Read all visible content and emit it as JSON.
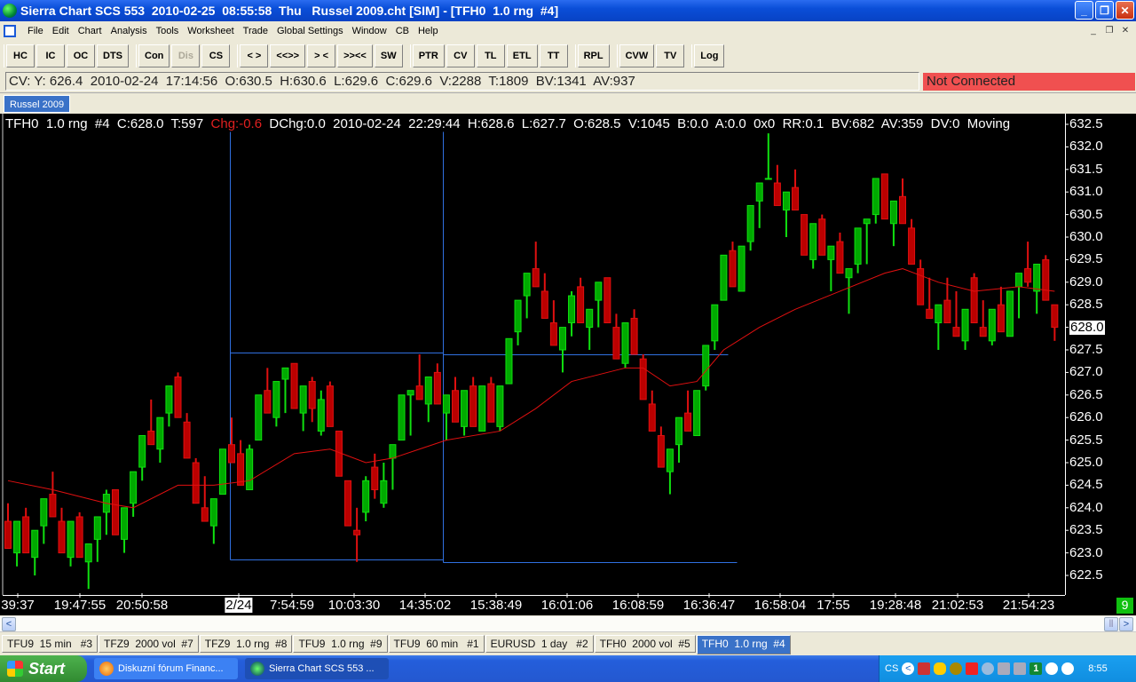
{
  "window": {
    "title": "Sierra Chart SCS 553  2010-02-25  08:55:58  Thu   Russel 2009.cht [SIM] - [TFH0  1.0 rng  #4]",
    "minimize": "_",
    "restore": "❐",
    "close": "✕"
  },
  "menu": [
    "File",
    "Edit",
    "Chart",
    "Analysis",
    "Tools",
    "Worksheet",
    "Trade",
    "Global Settings",
    "Window",
    "CB",
    "Help"
  ],
  "mdi": {
    "minimize": "_",
    "restore": "❐",
    "close": "✕"
  },
  "toolbar": [
    [
      "HC",
      "IC",
      "OC",
      "DTS"
    ],
    [
      "Con",
      "Dis",
      "CS"
    ],
    [
      "< >",
      "<<>>",
      "> <",
      ">><<",
      "SW"
    ],
    [
      "PTR",
      "CV",
      "TL",
      "ETL",
      "TT"
    ],
    [
      "RPL"
    ],
    [
      "CVW",
      "TV"
    ],
    [
      "Log"
    ]
  ],
  "toolbar_disabled": [
    "Dis"
  ],
  "infobar": {
    "text": "CV: Y: 626.4  2010-02-24  17:14:56  O:630.5  H:630.6  L:629.6  C:629.6  V:2288  T:1809  BV:1341  AV:937",
    "status": "Not Connected",
    "status_color": "#f05050"
  },
  "chartbook_tab": "Russel 2009",
  "chart": {
    "header_a": "TFH0  1.0 rng  #4  C:628.0  T:597  ",
    "header_chg": "Chg:-0.6",
    "header_b": "  DChg:0.0  2010-02-24  22:29:44  H:628.6  L:627.7  O:628.5  V:1045  B:0.0  A:0.0  0x0  RR:0.1  BV:682  AV:359  DV:0  Moving",
    "current_price": "628.0",
    "bar_count": "9",
    "up_color": "#10e010",
    "down_color": "#e01010",
    "ma_color": "#e01010",
    "drawing_color": "#3070e0"
  },
  "chart_data": {
    "type": "candlestick",
    "ylim": [
      622.5,
      632.5
    ],
    "yticks": [
      "632.5",
      "632.0",
      "631.5",
      "631.0",
      "630.5",
      "630.0",
      "629.5",
      "629.0",
      "628.5",
      "628.0",
      "627.5",
      "627.0",
      "626.5",
      "626.0",
      "625.5",
      "625.0",
      "624.5",
      "624.0",
      "623.5",
      "623.0",
      "622.5"
    ],
    "xticks": [
      "39:37",
      "19:47:55",
      "20:50:58",
      "2/24",
      "7:54:59",
      "10:03:30",
      "14:35:02",
      "15:38:49",
      "16:01:06",
      "16:08:59",
      "16:36:47",
      "16:58:04",
      "17:55",
      "19:28:48",
      "21:02:53",
      "21:54:23"
    ],
    "ohlc": [
      [
        623.7,
        624.1,
        623.1,
        623.1
      ],
      [
        623.0,
        623.7,
        622.7,
        623.7
      ],
      [
        623.8,
        624.0,
        623.0,
        623.0
      ],
      [
        622.9,
        623.5,
        622.5,
        623.5
      ],
      [
        623.6,
        624.2,
        623.2,
        624.2
      ],
      [
        624.3,
        624.8,
        623.8,
        623.8
      ],
      [
        623.7,
        624.0,
        623.0,
        623.0
      ],
      [
        622.9,
        623.7,
        622.7,
        623.7
      ],
      [
        623.8,
        623.9,
        622.9,
        622.9
      ],
      [
        622.8,
        623.2,
        622.2,
        623.2
      ],
      [
        623.3,
        623.8,
        622.8,
        623.8
      ],
      [
        623.9,
        624.4,
        623.4,
        624.3
      ],
      [
        624.4,
        624.4,
        623.4,
        623.4
      ],
      [
        623.3,
        624.0,
        623.0,
        624.0
      ],
      [
        624.1,
        624.8,
        623.8,
        624.8
      ],
      [
        624.9,
        625.6,
        624.6,
        625.6
      ],
      [
        625.7,
        626.4,
        625.4,
        625.4
      ],
      [
        625.3,
        626.0,
        625.0,
        626.0
      ],
      [
        626.1,
        626.7,
        625.8,
        626.7
      ],
      [
        626.9,
        627.0,
        626.0,
        626.0
      ],
      [
        625.9,
        626.1,
        625.1,
        625.1
      ],
      [
        625.0,
        625.1,
        624.1,
        624.1
      ],
      [
        624.0,
        624.7,
        623.7,
        623.7
      ],
      [
        623.6,
        624.2,
        623.2,
        624.2
      ],
      [
        624.3,
        625.3,
        624.3,
        625.3
      ],
      [
        625.4,
        626.0,
        625.0,
        625.0
      ],
      [
        625.2,
        625.5,
        624.5,
        624.5
      ],
      [
        624.4,
        625.4,
        624.4,
        625.3
      ],
      [
        625.5,
        626.5,
        625.5,
        626.5
      ],
      [
        626.6,
        627.1,
        626.1,
        626.1
      ],
      [
        626.0,
        626.8,
        625.8,
        626.8
      ],
      [
        626.85,
        627.1,
        626.1,
        627.1
      ],
      [
        627.2,
        627.2,
        626.2,
        626.2
      ],
      [
        626.1,
        626.7,
        625.7,
        626.7
      ],
      [
        626.8,
        626.9,
        625.9,
        626.2
      ],
      [
        625.7,
        626.6,
        625.6,
        626.4
      ],
      [
        626.7,
        626.8,
        625.8,
        625.8
      ],
      [
        625.7,
        625.7,
        624.7,
        624.7
      ],
      [
        624.6,
        624.6,
        623.6,
        623.6
      ],
      [
        623.5,
        624.0,
        622.8,
        623.4
      ],
      [
        623.9,
        624.7,
        623.7,
        624.6
      ],
      [
        624.9,
        625.2,
        624.2,
        624.4
      ],
      [
        624.1,
        625.0,
        624.0,
        624.6
      ],
      [
        625.1,
        625.4,
        624.4,
        625.4
      ],
      [
        625.5,
        626.5,
        625.5,
        626.5
      ],
      [
        626.5,
        626.6,
        625.6,
        626.6
      ],
      [
        626.7,
        627.4,
        626.4,
        626.4
      ],
      [
        626.3,
        626.9,
        625.9,
        626.9
      ],
      [
        627.0,
        627.2,
        626.3,
        626.3
      ],
      [
        626.1,
        626.5,
        625.5,
        626.5
      ],
      [
        626.6,
        626.9,
        625.9,
        625.9
      ],
      [
        625.8,
        626.6,
        625.6,
        626.6
      ],
      [
        626.7,
        626.9,
        625.8,
        625.8
      ],
      [
        625.7,
        626.7,
        625.7,
        626.7
      ],
      [
        626.75,
        626.9,
        625.9,
        625.9
      ],
      [
        625.8,
        626.7,
        625.7,
        626.7
      ],
      [
        626.75,
        627.75,
        626.75,
        627.75
      ],
      [
        627.9,
        628.6,
        627.6,
        628.6
      ],
      [
        628.7,
        629.2,
        628.2,
        629.2
      ],
      [
        629.3,
        629.9,
        628.9,
        628.9
      ],
      [
        628.8,
        629.2,
        628.2,
        628.2
      ],
      [
        628.1,
        628.6,
        627.6,
        627.6
      ],
      [
        627.5,
        628.0,
        627.0,
        628.0
      ],
      [
        628.1,
        628.8,
        627.8,
        628.7
      ],
      [
        628.9,
        629.1,
        628.1,
        628.1
      ],
      [
        628.0,
        628.4,
        627.5,
        628.4
      ],
      [
        628.6,
        629.0,
        628.0,
        629.0
      ],
      [
        629.1,
        629.1,
        628.1,
        628.1
      ],
      [
        628.0,
        628.3,
        627.3,
        627.3
      ],
      [
        627.2,
        628.1,
        627.1,
        628.1
      ],
      [
        628.2,
        628.4,
        627.4,
        627.4
      ],
      [
        627.3,
        627.4,
        626.4,
        626.4
      ],
      [
        626.3,
        626.6,
        625.7,
        625.7
      ],
      [
        625.6,
        625.8,
        624.9,
        624.9
      ],
      [
        624.8,
        625.3,
        624.3,
        625.3
      ],
      [
        625.4,
        626.0,
        625.0,
        626.0
      ],
      [
        626.1,
        626.6,
        625.7,
        625.7
      ],
      [
        625.6,
        626.6,
        625.6,
        626.6
      ],
      [
        626.7,
        627.6,
        626.6,
        627.6
      ],
      [
        627.7,
        628.5,
        627.5,
        628.5
      ],
      [
        628.6,
        629.6,
        628.6,
        629.6
      ],
      [
        629.7,
        629.9,
        628.9,
        628.9
      ],
      [
        628.8,
        629.8,
        628.8,
        629.8
      ],
      [
        629.9,
        630.7,
        629.7,
        630.7
      ],
      [
        630.8,
        631.2,
        630.2,
        631.2
      ],
      [
        631.3,
        632.3,
        631.3,
        631.3
      ],
      [
        631.2,
        631.6,
        630.7,
        630.7
      ],
      [
        630.6,
        631.0,
        630.0,
        631.0
      ],
      [
        631.1,
        631.5,
        630.6,
        630.6
      ],
      [
        630.5,
        630.5,
        629.6,
        629.6
      ],
      [
        629.5,
        630.3,
        629.3,
        630.3
      ],
      [
        630.4,
        630.5,
        629.6,
        629.6
      ],
      [
        629.5,
        629.8,
        628.8,
        629.8
      ],
      [
        629.9,
        630.1,
        629.2,
        629.2
      ],
      [
        629.1,
        629.3,
        628.3,
        629.3
      ],
      [
        629.4,
        630.2,
        629.2,
        630.2
      ],
      [
        630.3,
        630.4,
        629.4,
        630.4
      ],
      [
        630.5,
        631.3,
        630.3,
        631.3
      ],
      [
        631.4,
        631.4,
        630.4,
        630.4
      ],
      [
        630.3,
        630.8,
        629.8,
        630.8
      ],
      [
        630.9,
        631.3,
        630.3,
        630.3
      ],
      [
        630.2,
        630.4,
        629.4,
        629.4
      ],
      [
        629.3,
        629.5,
        628.5,
        628.5
      ],
      [
        628.4,
        629.1,
        628.2,
        628.2
      ],
      [
        628.1,
        628.5,
        627.5,
        628.5
      ],
      [
        628.6,
        629.1,
        628.1,
        628.1
      ],
      [
        628.0,
        628.8,
        627.8,
        627.8
      ],
      [
        627.7,
        628.4,
        627.5,
        628.4
      ],
      [
        629.1,
        629.2,
        628.1,
        628.1
      ],
      [
        628.0,
        628.6,
        627.8,
        627.8
      ],
      [
        627.7,
        628.4,
        627.6,
        628.4
      ],
      [
        628.5,
        628.9,
        627.9,
        627.9
      ],
      [
        627.8,
        628.8,
        627.8,
        628.8
      ],
      [
        628.9,
        629.2,
        628.2,
        629.2
      ],
      [
        629.3,
        629.9,
        628.9,
        629.0
      ],
      [
        628.8,
        629.4,
        628.3,
        629.4
      ],
      [
        629.5,
        629.6,
        628.6,
        628.6
      ],
      [
        628.5,
        628.5,
        627.7,
        628.0
      ]
    ],
    "moving_average": [
      [
        0,
        624.6
      ],
      [
        5,
        624.4
      ],
      [
        11,
        624.1
      ],
      [
        14,
        624.0
      ],
      [
        19,
        624.5
      ],
      [
        23,
        624.5
      ],
      [
        27,
        624.6
      ],
      [
        32,
        625.2
      ],
      [
        36,
        625.3
      ],
      [
        40,
        625.0
      ],
      [
        43,
        625.1
      ],
      [
        46,
        625.3
      ],
      [
        49,
        625.5
      ],
      [
        55,
        625.7
      ],
      [
        59,
        626.2
      ],
      [
        63,
        626.8
      ],
      [
        69,
        627.1
      ],
      [
        71,
        627.1
      ],
      [
        74,
        626.7
      ],
      [
        77,
        626.8
      ],
      [
        80,
        627.5
      ],
      [
        84,
        628.0
      ],
      [
        88,
        628.4
      ],
      [
        93,
        628.8
      ],
      [
        98,
        629.2
      ],
      [
        100,
        629.3
      ],
      [
        104,
        629.0
      ],
      [
        108,
        628.8
      ],
      [
        113,
        628.9
      ],
      [
        117,
        628.8
      ]
    ]
  },
  "chart_tabs": [
    "TFU9  15 min   #3",
    "TFZ9  2000 vol  #7",
    "TFZ9  1.0 rng  #8",
    "TFU9  1.0 rng  #9",
    "TFU9  60 min   #1",
    "EURUSD  1 day   #2",
    "TFH0  2000 vol  #5",
    "TFH0  1.0 rng  #4"
  ],
  "active_chart_tab": 7,
  "taskbar": {
    "start": "Start",
    "tasks": [
      "Diskuzní fórum Financ...",
      "Sierra Chart SCS 553 ..."
    ],
    "lang": "CS",
    "clock": "8:55",
    "tray_number": "1"
  }
}
